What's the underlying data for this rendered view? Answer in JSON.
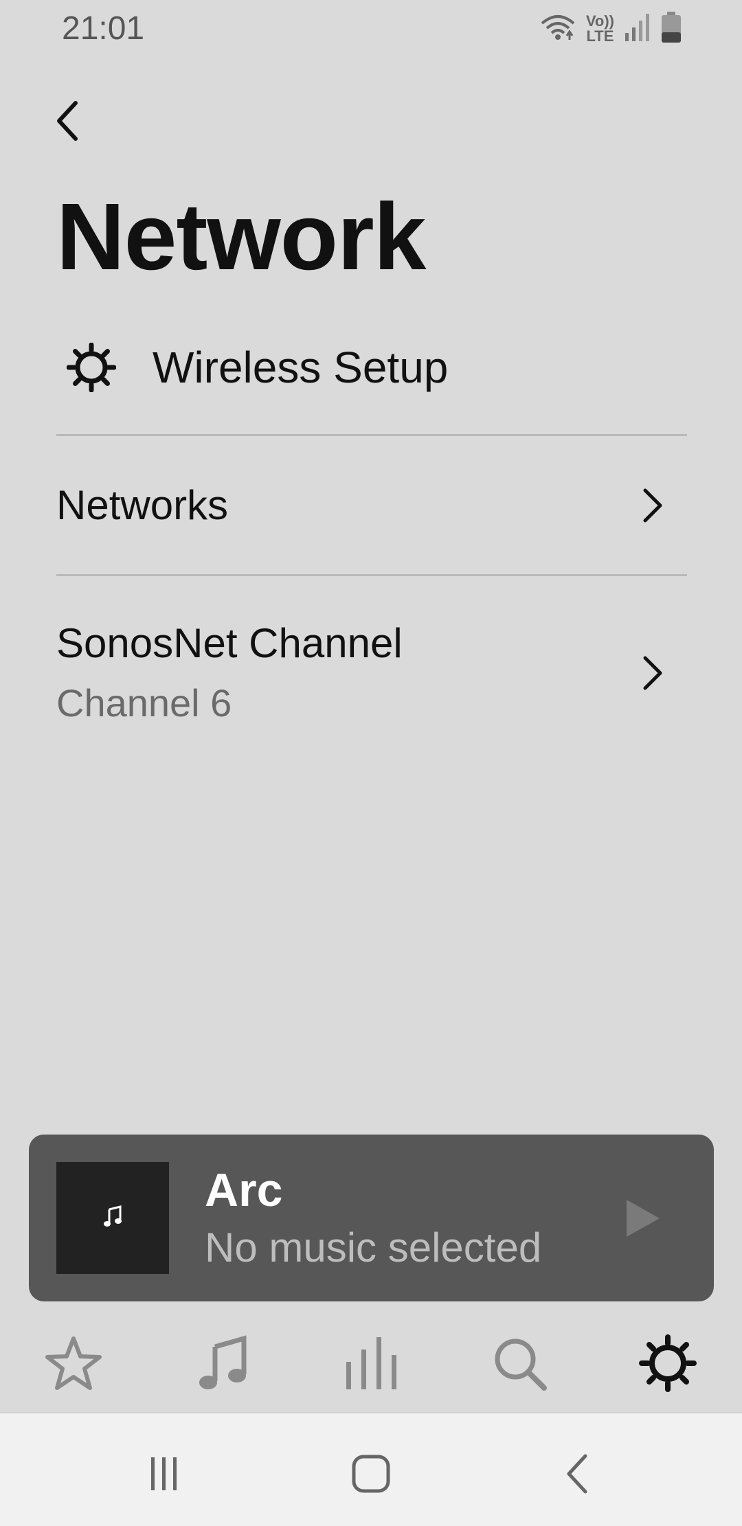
{
  "status_bar": {
    "time": "21:01",
    "network_label_top": "Vo))",
    "network_label_bottom": "LTE",
    "icons": [
      "wifi-icon",
      "volte-icon",
      "signal-icon",
      "battery-icon"
    ]
  },
  "header": {
    "back_icon": "chevron-left-icon",
    "title": "Network"
  },
  "wireless_setup": {
    "icon": "gear-icon",
    "label": "Wireless Setup"
  },
  "items": [
    {
      "title": "Networks",
      "subtitle": "",
      "icon": "chevron-right-icon"
    },
    {
      "title": "SonosNet Channel",
      "subtitle": "Channel 6",
      "icon": "chevron-right-icon"
    }
  ],
  "now_playing": {
    "room": "Arc",
    "track": "No music selected",
    "art_icon": "music-note-icon",
    "play_icon": "play-icon"
  },
  "tabs": [
    {
      "name": "favorites",
      "icon": "star-icon",
      "active": false
    },
    {
      "name": "browse",
      "icon": "music-note-icon",
      "active": false
    },
    {
      "name": "rooms",
      "icon": "rooms-bars-icon",
      "active": false
    },
    {
      "name": "search",
      "icon": "search-icon",
      "active": false
    },
    {
      "name": "settings",
      "icon": "gear-icon",
      "active": true
    }
  ],
  "system_nav": [
    "recents-icon",
    "home-icon",
    "back-icon"
  ],
  "colors": {
    "background": "#dadada",
    "now_playing_bg": "#575757",
    "active_tab": "#111111",
    "inactive_tab": "#8a8a8a"
  }
}
